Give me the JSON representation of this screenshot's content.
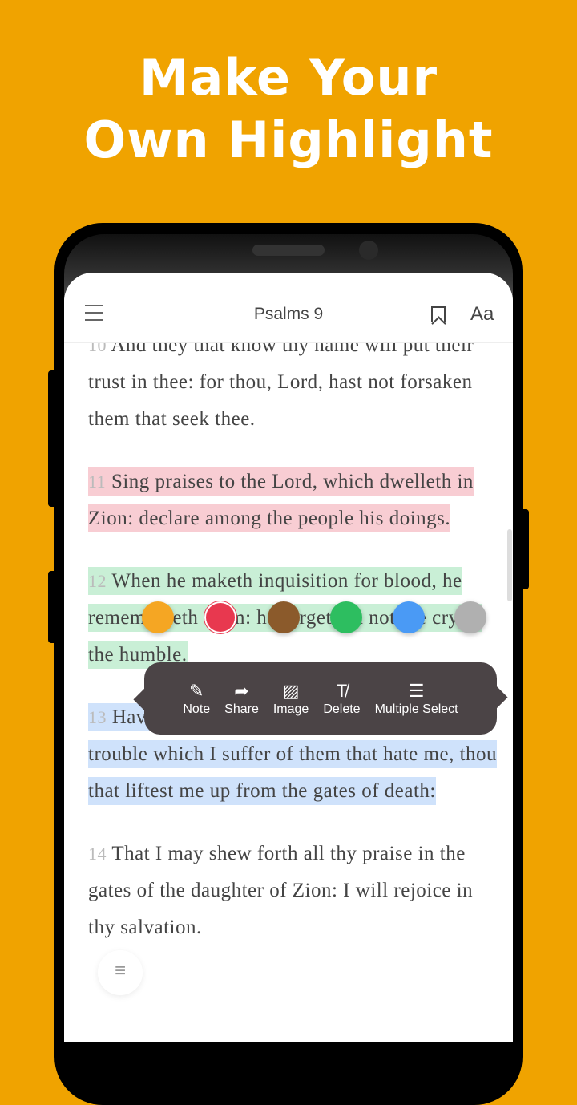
{
  "headline": {
    "line1": "Make Your",
    "line2": "Own Highlight"
  },
  "header": {
    "title": "Psalms 9",
    "font_label": "Aa",
    "icons": [
      "menu-icon",
      "bookmark-icon"
    ]
  },
  "verses": [
    {
      "num": "10",
      "text": "And they that know thy name will put their trust in thee: for thou, Lord, hast not forsaken them that seek thee.",
      "highlight": null
    },
    {
      "num": "11",
      "text": "Sing praises to the Lord, which dwelleth in Zion: declare among the people his doings.",
      "highlight": "#f8cdd3"
    },
    {
      "num": "12",
      "text": "When he maketh inquisition for blood, he remembereth them: he forgetteth not the cry of the humble.",
      "highlight": "#c9efd6"
    },
    {
      "num": "13",
      "text": "Have mercy upon me, O Lord; consider my trouble which I suffer of them that hate me, thou that liftest me up from the gates of death:",
      "highlight": "#cfe2fb"
    },
    {
      "num": "14",
      "text": "That I may shew forth all thy praise in the gates of the daughter of Zion: I will rejoice in thy salvation.",
      "highlight": null
    }
  ],
  "highlight_colors": [
    "#F5A623",
    "#E8384F",
    "#8B5A2B",
    "#2DBE60",
    "#4A9AF5",
    "#B0B0B0"
  ],
  "selected_color": "#E8384F",
  "context_menu": [
    {
      "label": "Note",
      "icon": "pencil-icon"
    },
    {
      "label": "Share",
      "icon": "share-icon"
    },
    {
      "label": "Image",
      "icon": "image-icon"
    },
    {
      "label": "Delete",
      "icon": "clear-format-icon"
    },
    {
      "label": "Multiple Select",
      "icon": "checklist-icon"
    }
  ]
}
